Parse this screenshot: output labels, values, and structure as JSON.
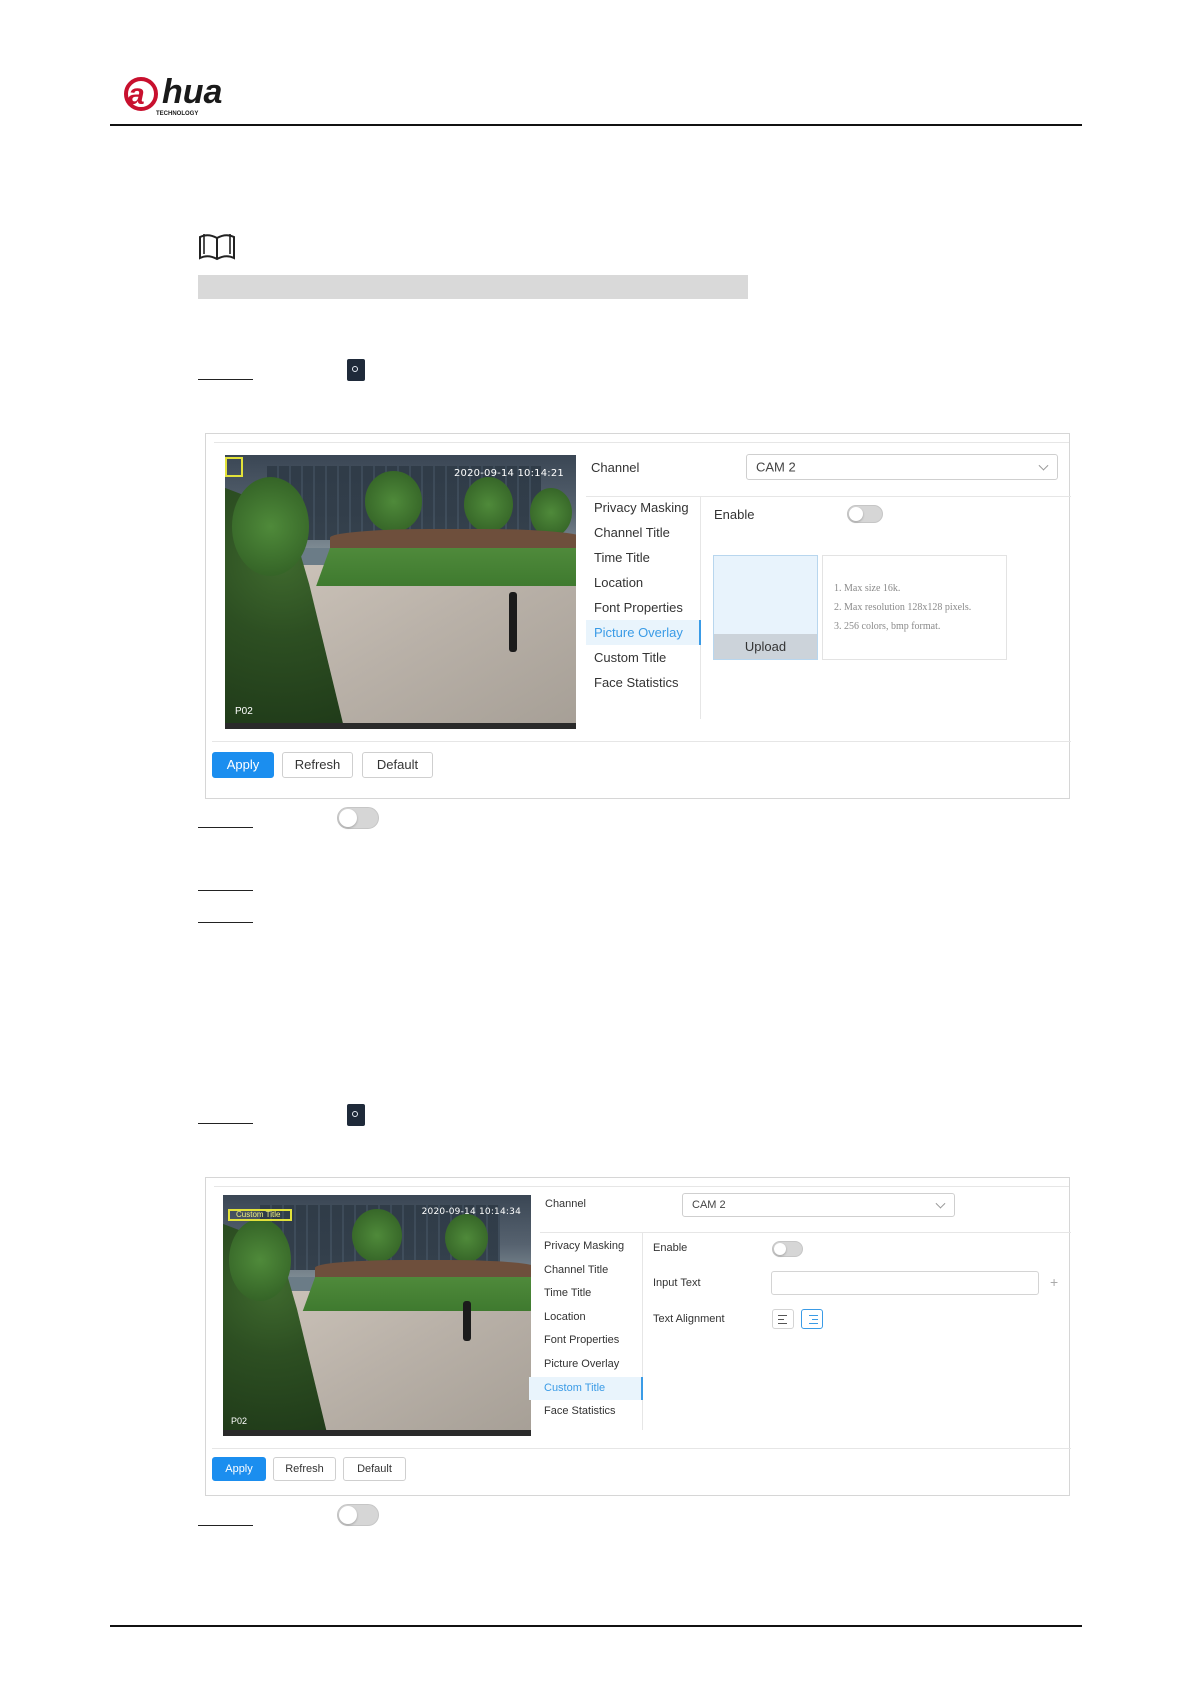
{
  "colors": {
    "accent": "#1b8eef",
    "active_menu": "#3a9be6",
    "logo_red": "#c8102e"
  },
  "logo": {
    "text_prefix": "a",
    "text_main": "hua",
    "tagline": "TECHNOLOGY"
  },
  "icons": {
    "note": "book-icon",
    "settings": "gear-icon",
    "toggle": "toggle-switch-icon"
  },
  "panel1": {
    "timestamp": "2020-09-14 10:14:21",
    "corner_label": "P02",
    "channel_label": "Channel",
    "channel_value": "CAM 2",
    "menu": [
      "Privacy Masking",
      "Channel Title",
      "Time Title",
      "Location",
      "Font Properties",
      "Picture Overlay",
      "Custom Title",
      "Face Statistics"
    ],
    "active_menu_index": 5,
    "enable_label": "Enable",
    "enable_on": false,
    "upload_label": "Upload",
    "rules": [
      "1. Max size 16k.",
      "2. Max resolution 128x128 pixels.",
      "3. 256 colors, bmp format."
    ],
    "buttons": {
      "apply": "Apply",
      "refresh": "Refresh",
      "default": "Default"
    }
  },
  "panel2": {
    "timestamp": "2020-09-14 10:14:34",
    "osd_label": "Custom Title",
    "corner_label": "P02",
    "channel_label": "Channel",
    "channel_value": "CAM 2",
    "menu": [
      "Privacy Masking",
      "Channel Title",
      "Time Title",
      "Location",
      "Font Properties",
      "Picture Overlay",
      "Custom Title",
      "Face Statistics"
    ],
    "active_menu_index": 6,
    "enable_label": "Enable",
    "enable_on": false,
    "input_text_label": "Input Text",
    "input_text_value": "",
    "text_alignment_label": "Text Alignment",
    "buttons": {
      "apply": "Apply",
      "refresh": "Refresh",
      "default": "Default"
    }
  }
}
